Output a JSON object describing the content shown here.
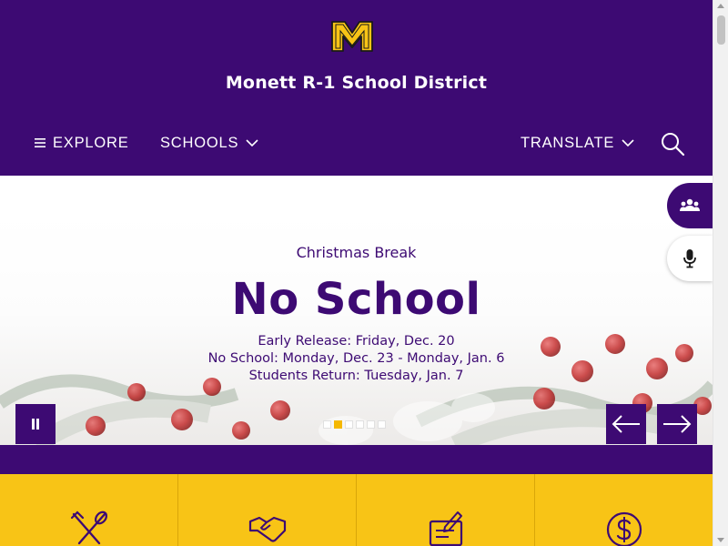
{
  "header": {
    "logo_letter": "M",
    "site_title": "Monett R-1 School District",
    "nav": {
      "explore": "EXPLORE",
      "schools": "SCHOOLS",
      "translate": "TRANSLATE"
    }
  },
  "hero": {
    "kicker": "Christmas Break",
    "title": "No School",
    "lines": [
      "Early Release: Friday, Dec. 20",
      "No School: Monday, Dec. 23 - Monday, Jan. 6",
      "Students Return: Tuesday, Jan. 7"
    ],
    "slide_count": 6,
    "active_slide_index": 1
  },
  "quicklinks": [
    {
      "icon": "utensils-icon"
    },
    {
      "icon": "handshake-icon"
    },
    {
      "icon": "form-icon"
    },
    {
      "icon": "dollar-icon"
    }
  ],
  "colors": {
    "brand_purple": "#3d0a73",
    "brand_gold": "#f8c416",
    "white": "#ffffff"
  }
}
